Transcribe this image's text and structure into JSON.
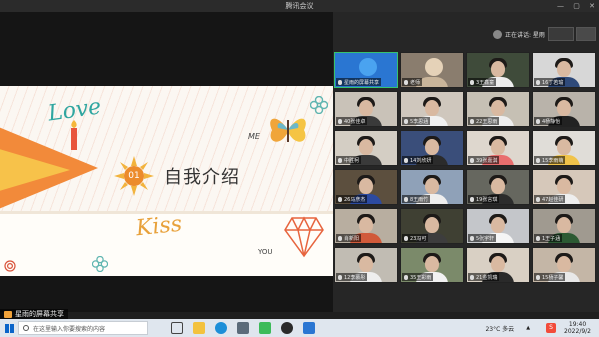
{
  "window": {
    "title": "腾讯会议",
    "controls": [
      "—",
      "▢",
      "✕"
    ]
  },
  "share": {
    "presenter_label": "星雨的屏幕共享",
    "slide": {
      "number": "01",
      "title": "自我介绍",
      "deco_love": "Love",
      "deco_kiss": "Kiss",
      "deco_me": "ME",
      "deco_you": "YOU"
    }
  },
  "speaker": {
    "label": "正在讲话: 星雨"
  },
  "participants": [
    {
      "name": "星雨的屏幕共享",
      "active": true,
      "bg": "#2a76d2",
      "body": "#2a76d2",
      "avatar": true
    },
    {
      "name": "老师",
      "bg": "#8a7d6e",
      "body": "#c9b59a",
      "avatar": true
    },
    {
      "name": "3王鑫童",
      "bg": "#3f4b3a",
      "body": "#eeeeee"
    },
    {
      "name": "16丁若瑜",
      "bg": "#d7d7d7",
      "body": "#2f4a7a"
    },
    {
      "name": "40张佳卓",
      "bg": "#c9c2b8",
      "body": "#3a3a3a"
    },
    {
      "name": "5李思涵",
      "bg": "#cfc7bd",
      "body": "#f1f1f1"
    },
    {
      "name": "22王思雨",
      "bg": "#c6c0b4",
      "body": "#eeeeee"
    },
    {
      "name": "4杨静怡",
      "bg": "#b9b3aa",
      "body": "#222222"
    },
    {
      "name": "中胜柯",
      "bg": "#d4cec4",
      "body": "#3a3a3a"
    },
    {
      "name": "14刘欣妍",
      "bg": "#3a4e7a",
      "body": "#2b2b2b"
    },
    {
      "name": "39张嘉淇",
      "bg": "#ded7ce",
      "body": "#e96e6e"
    },
    {
      "name": "15李雨萌",
      "bg": "#e0ddd8",
      "body": "#f0c34a"
    },
    {
      "name": "26马彦杰",
      "bg": "#5c4f3e",
      "body": "#2c4aa0"
    },
    {
      "name": "8王雨竹",
      "bg": "#8fa1b8",
      "body": "#eeeeee"
    },
    {
      "name": "19张言琪",
      "bg": "#66675f",
      "body": "#2c2c2c"
    },
    {
      "name": "47赵佳研",
      "bg": "#d6c8ba",
      "body": "#eeeeee"
    },
    {
      "name": "肖新阳",
      "bg": "#b8aea0",
      "body": "#d15a3a"
    },
    {
      "name": "23冯可",
      "bg": "#3f4033",
      "body": "#3d3d3d"
    },
    {
      "name": "5张宇轩",
      "bg": "#c4c6ca",
      "body": "#f5f5f5"
    },
    {
      "name": "1王子涵",
      "bg": "#a09a90",
      "body": "#2c5a33"
    },
    {
      "name": "12李慕彤",
      "bg": "#c1bcb3",
      "body": "#eeeeee"
    },
    {
      "name": "35王彩雨",
      "bg": "#7b8a6a",
      "body": "#f2f2f2"
    },
    {
      "name": "21金凯瑞",
      "bg": "#d9d0c4",
      "body": "#2a2a2a"
    },
    {
      "name": "15杨子馨",
      "bg": "#c4b6a6",
      "body": "#e8e8e8"
    }
  ],
  "taskbar": {
    "search_placeholder": "在这里输入你要搜索的内容",
    "weather": "23°C 多云",
    "time": "19:40",
    "date": "2022/9/2",
    "ime": "S"
  },
  "colors": {
    "active_border": "#37c36f",
    "accent": "#2a76d2"
  }
}
